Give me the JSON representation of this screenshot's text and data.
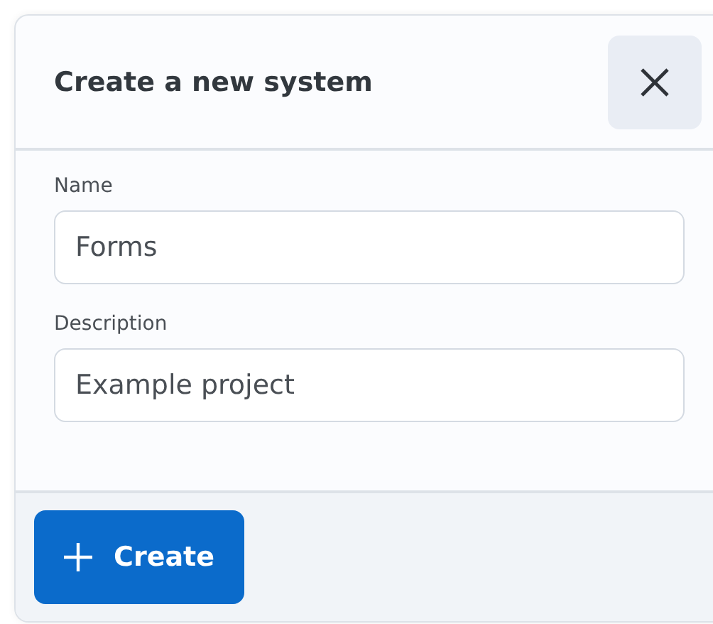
{
  "dialog": {
    "title": "Create a new system"
  },
  "fields": [
    {
      "label": "Name",
      "value": "Forms"
    },
    {
      "label": "Description",
      "value": "Example project"
    }
  ],
  "primary_button": {
    "label": "Create"
  }
}
